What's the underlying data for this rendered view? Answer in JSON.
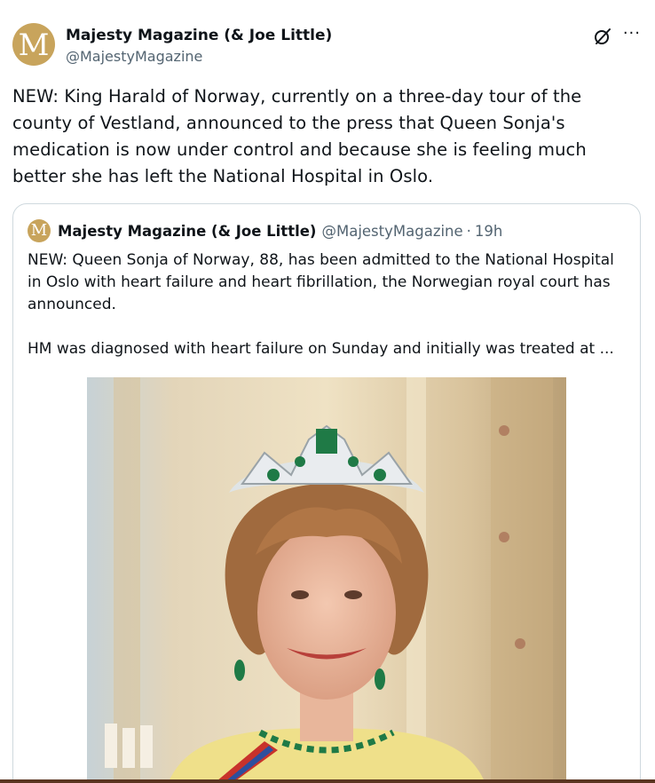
{
  "post": {
    "author_name": "Majesty Magazine (& Joe Little)",
    "author_handle": "@MajestyMagazine",
    "avatar_letter": "M",
    "text": "NEW: King Harald of Norway, currently on a three-day tour of the county of Vestland, announced to the press that Queen Sonja's medication is now under control and because she is feeling much better she has left the National Hospital in Oslo.",
    "more_label": "···"
  },
  "quoted": {
    "author_name": "Majesty Magazine (& Joe Little)",
    "author_handle": "@MajestyMagazine",
    "separator": "·",
    "time": "19h",
    "avatar_letter": "M",
    "paragraph1": "NEW: Queen Sonja of Norway, 88, has been admitted to the National Hospital in Oslo with heart failure and heart fibrillation, the Norwegian royal court has announced.",
    "paragraph2": "HM was diagnosed with heart failure on Sunday and initially was treated at ..."
  },
  "colors": {
    "brand_gold": "#c8a45c",
    "secondary_text": "#536471",
    "border": "#cfd9de"
  },
  "icons": [
    "grok-icon",
    "more-icon"
  ]
}
